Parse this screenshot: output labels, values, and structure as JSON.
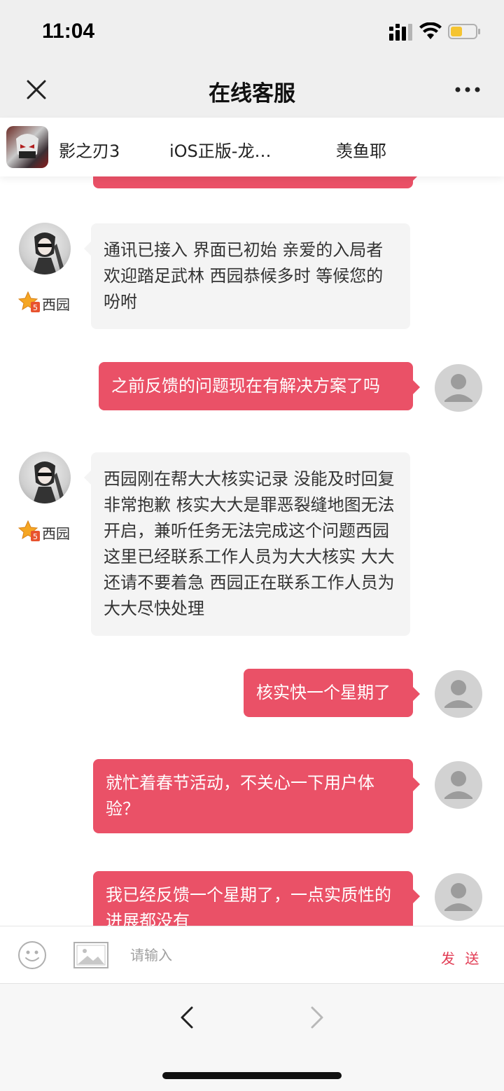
{
  "status_bar": {
    "time": "11:04"
  },
  "nav": {
    "title": "在线客服"
  },
  "game": {
    "name": "影之刃3",
    "server": "iOS正版-龙…",
    "role": "羡鱼耶"
  },
  "agent": {
    "name": "西园"
  },
  "messages": [
    {
      "from": "agent",
      "text": "通讯已接入 界面已初始 亲爱的入局者 欢迎踏足武林 西园恭候多时 等候您的吩咐"
    },
    {
      "from": "user",
      "text": "之前反馈的问题现在有解决方案了吗"
    },
    {
      "from": "agent",
      "text": "西园刚在帮大大核实记录 没能及时回复非常抱歉 核实大大是罪恶裂缝地图无法开启，兼听任务无法完成这个问题西园这里已经联系工作人员为大大核实 大大还请不要着急 西园正在联系工作人员为大大尽快处理"
    },
    {
      "from": "user",
      "text": "核实快一个星期了"
    },
    {
      "from": "user",
      "text": "就忙着春节活动，不关心一下用户体验？"
    },
    {
      "from": "user",
      "text": "我已经反馈一个星期了，一点实质性的进展都没有"
    }
  ],
  "input": {
    "placeholder": "请输入",
    "send_label": "发 送"
  },
  "colors": {
    "user_bubble": "#ea5167",
    "agent_bubble": "#f4f4f4",
    "send": "#e23c54"
  }
}
